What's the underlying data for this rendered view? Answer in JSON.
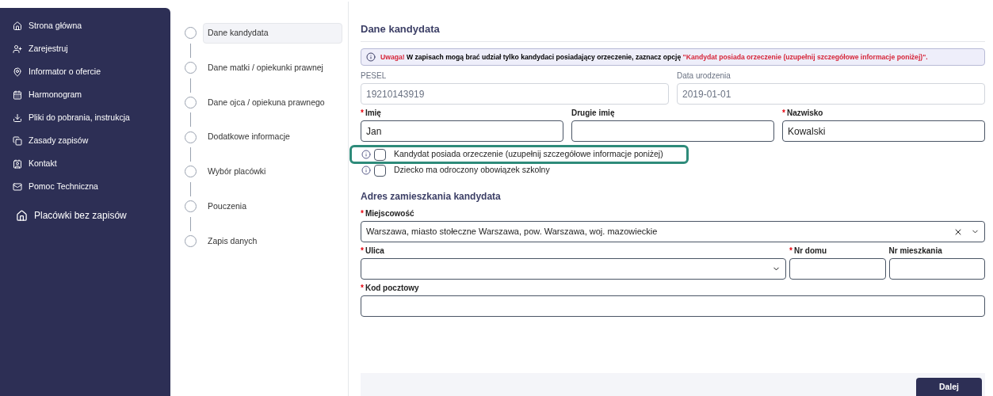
{
  "sidebar": {
    "items": [
      {
        "label": "Strona główna",
        "kind": "link"
      },
      {
        "label": "Zarejestruj",
        "kind": "link"
      },
      {
        "label": "Informator o ofercie",
        "kind": "link"
      },
      {
        "label": "Harmonogram",
        "kind": "link"
      },
      {
        "label": "Pliki do pobrania, instrukcja",
        "kind": "link"
      },
      {
        "label": "Zasady zapisów",
        "kind": "link"
      },
      {
        "label": "Kontakt",
        "kind": "link"
      },
      {
        "label": "Pomoc Techniczna",
        "kind": "link"
      },
      {
        "label": "Placówki bez zapisów",
        "kind": "featured"
      }
    ]
  },
  "steps": [
    {
      "label": "Dane kandydata",
      "selected": true
    },
    {
      "label": "Dane matki / opiekunki prawnej",
      "selected": false
    },
    {
      "label": "Dane ojca / opiekuna prawnego",
      "selected": false
    },
    {
      "label": "Dodatkowe informacje",
      "selected": false
    },
    {
      "label": "Wybór placówki",
      "selected": false
    },
    {
      "label": "Pouczenia",
      "selected": false
    },
    {
      "label": "Zapis danych",
      "selected": false
    }
  ],
  "title": "Dane kandydata",
  "alert": {
    "label": "Uwaga!",
    "text": "W zapisach mogą brać udział tylko kandydaci posiadający orzeczenie, zaznacz opcję",
    "highlight": "\"Kandydat posiada orzeczenie (uzupełnij szczegółowe informacje poniżej)\"."
  },
  "fields_row_1": [
    {
      "label": "PESEL",
      "value": "19210143919",
      "disabled": true
    },
    {
      "label": "Data urodzenia",
      "value": "2019-01-01",
      "disabled": true
    }
  ],
  "fields_row_2": [
    {
      "required_mark": "*",
      "label": "Imię",
      "value": "Jan",
      "disabled": false
    },
    {
      "label": "Drugie imię",
      "disabled": false
    },
    {
      "required_mark": "*",
      "label": "Nazwisko",
      "value": "Kowalski",
      "disabled": false
    }
  ],
  "checkboxes": [
    {
      "label": "Kandydat posiada orzeczenie (uzupełnij szczegółowe informacje poniżej)",
      "checked": false,
      "highlighted": true
    },
    {
      "label": "Dziecko ma odroczony obowiązek szkolny",
      "checked": false,
      "highlighted": false
    }
  ],
  "address": {
    "title": "Adres zamieszkania kandydata",
    "city": {
      "required_mark": "*",
      "label": "Miejscowość",
      "value": "Warszawa, miasto stołeczne Warszawa, pow. Warszawa, woj. mazowieckie"
    },
    "row": [
      {
        "required_mark": "*",
        "label": "Ulica",
        "kind": "select"
      },
      {
        "required_mark": "*",
        "label": "Nr domu",
        "kind": "text"
      },
      {
        "label": "Nr mieszkania",
        "kind": "text"
      }
    ],
    "postal": {
      "required_mark": "*",
      "label": "Kod pocztowy"
    }
  },
  "next_button": "Dalej"
}
